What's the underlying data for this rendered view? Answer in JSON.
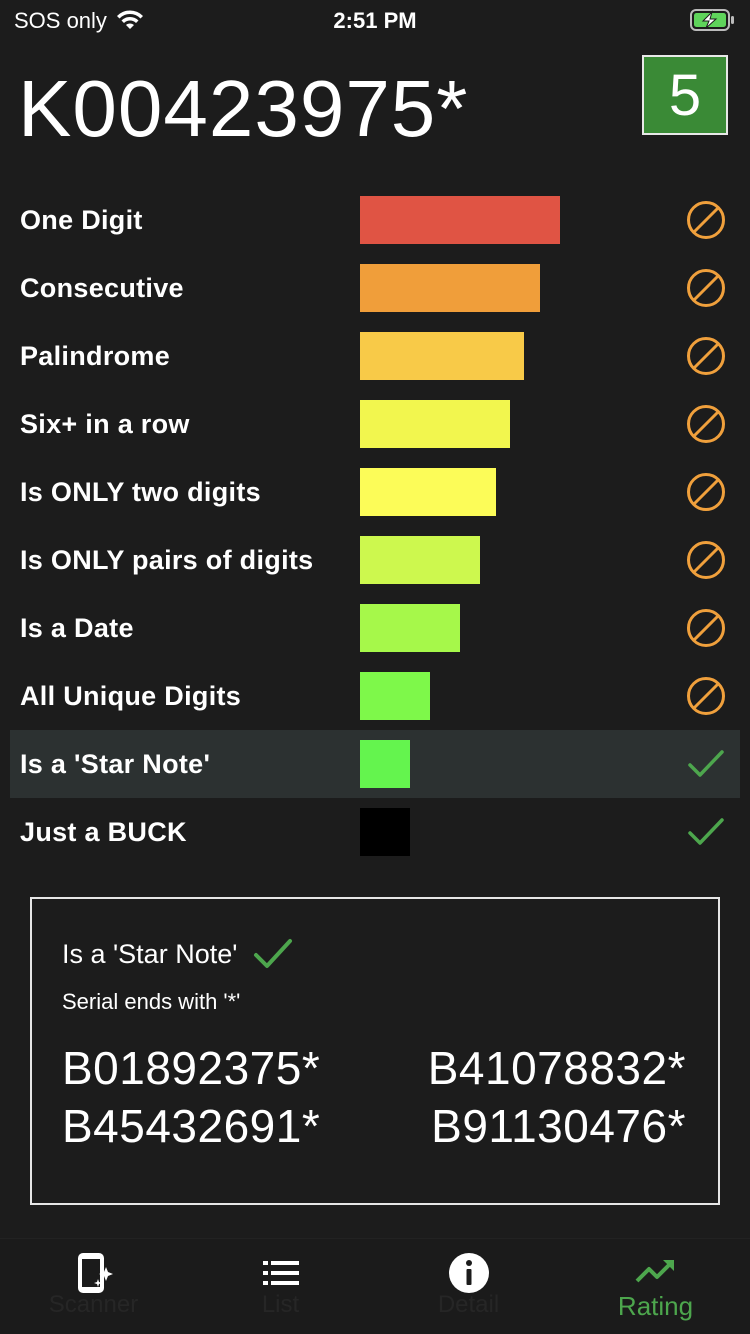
{
  "status_bar": {
    "carrier": "SOS only",
    "time": "2:51 PM"
  },
  "header": {
    "serial": "K00423975*",
    "score": "5"
  },
  "criteria": [
    {
      "label": "One Digit",
      "bar_fraction": 1.0,
      "bar_color": "#e05444",
      "status": "not-met"
    },
    {
      "label": "Consecutive",
      "bar_fraction": 0.9,
      "bar_color": "#f09e3a",
      "status": "not-met"
    },
    {
      "label": "Palindrome",
      "bar_fraction": 0.82,
      "bar_color": "#f8ca48",
      "status": "not-met"
    },
    {
      "label": "Six+ in a row",
      "bar_fraction": 0.75,
      "bar_color": "#f2f64e",
      "status": "not-met"
    },
    {
      "label": "Is ONLY two digits",
      "bar_fraction": 0.68,
      "bar_color": "#fcfc58",
      "status": "not-met"
    },
    {
      "label": "Is ONLY pairs of digits",
      "bar_fraction": 0.6,
      "bar_color": "#cdf84e",
      "status": "not-met"
    },
    {
      "label": "Is a Date",
      "bar_fraction": 0.5,
      "bar_color": "#a6f84a",
      "status": "not-met"
    },
    {
      "label": "All Unique Digits",
      "bar_fraction": 0.35,
      "bar_color": "#7ef84a",
      "status": "not-met"
    },
    {
      "label": "Is a 'Star Note'",
      "bar_fraction": 0.25,
      "bar_color": "#64f44e",
      "status": "met"
    },
    {
      "label": "Just a BUCK",
      "bar_fraction": 0.25,
      "bar_color": "#000000",
      "status": "met"
    }
  ],
  "highlighted_index": 8,
  "detail": {
    "title": "Is a 'Star Note'",
    "description": "Serial ends with '*'",
    "examples": [
      "B01892375*",
      "B41078832*",
      "B45432691*",
      "B91130476*"
    ]
  },
  "tabs": [
    {
      "label": "Scanner",
      "icon": "scanner-icon",
      "active": false
    },
    {
      "label": "List",
      "icon": "list-icon",
      "active": false
    },
    {
      "label": "Detail",
      "icon": "info-icon",
      "active": false
    },
    {
      "label": "Rating",
      "icon": "trending-up-icon",
      "active": true
    }
  ],
  "colors": {
    "background": "#1c1c1c",
    "badge": "#3a8a36",
    "not_met": "#f0a03c",
    "met": "#4da64d",
    "highlight_row": "#2c3131"
  }
}
